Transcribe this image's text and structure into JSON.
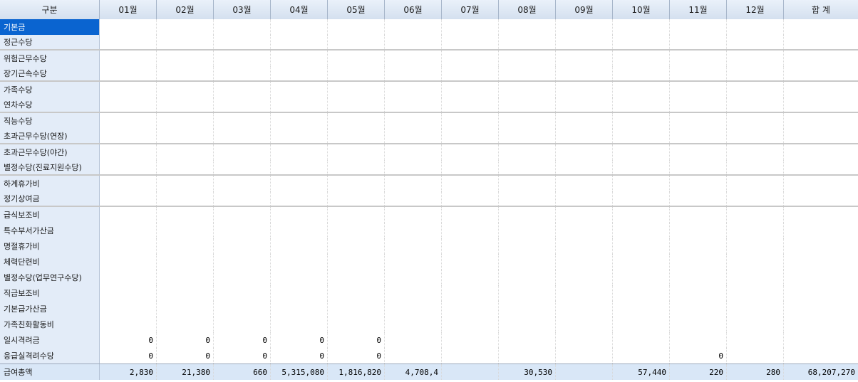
{
  "grid": {
    "header": {
      "label": "구분",
      "months": [
        "01월",
        "02월",
        "03월",
        "04월",
        "05월",
        "06월",
        "07월",
        "08월",
        "09월",
        "10월",
        "11월",
        "12월"
      ],
      "total": "합 계"
    },
    "rows": [
      {
        "label": "기본금"
      },
      {
        "label": "정근수당"
      },
      {
        "label": "위험근무수당"
      },
      {
        "label": "장기근속수당"
      },
      {
        "label": "가족수당"
      },
      {
        "label": "연차수당"
      },
      {
        "label": "직능수당"
      },
      {
        "label": "초과근무수당(연장)"
      },
      {
        "label": "초과근무수당(야간)"
      },
      {
        "label": "별정수당(진료지원수당)"
      },
      {
        "label": "하계휴가비"
      },
      {
        "label": "정기상여금"
      },
      {
        "label": "급식보조비"
      },
      {
        "label": "특수부서가산금"
      },
      {
        "label": "명절휴가비"
      },
      {
        "label": "체력단련비"
      },
      {
        "label": "별정수당(업무연구수당)"
      },
      {
        "label": "직급보조비"
      },
      {
        "label": "기본급가산금"
      },
      {
        "label": "가족친화활동비"
      },
      {
        "label": "일시격려금",
        "months": [
          "0",
          "0",
          "0",
          "0",
          "0",
          "",
          "",
          "",
          "",
          "",
          "",
          ""
        ]
      },
      {
        "label": "응급실격려수당",
        "months": [
          "0",
          "0",
          "0",
          "0",
          "0",
          "",
          "",
          "",
          "",
          "",
          "0",
          ""
        ]
      }
    ],
    "total_row": {
      "label": "급여총액",
      "months": [
        "2,830",
        "21,380",
        "660",
        "5,315,080",
        "1,816,820",
        "4,708,4",
        "",
        "30,530",
        "",
        "57,440",
        "220",
        "280"
      ],
      "total": "68,207,270"
    }
  }
}
